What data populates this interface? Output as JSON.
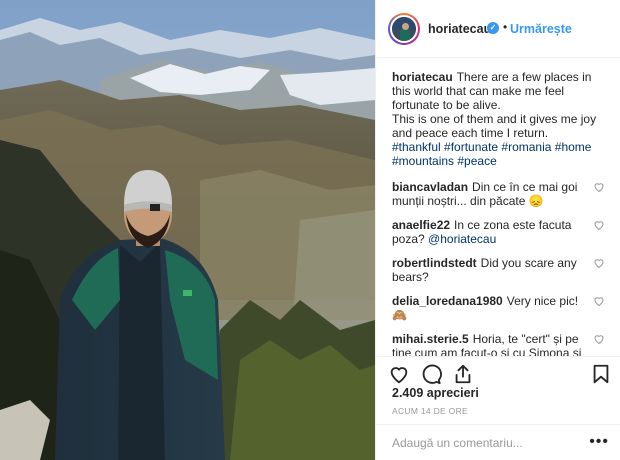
{
  "post": {
    "username": "horiatecau",
    "follow_label": "Urmărește",
    "dot": "•",
    "caption": {
      "username": "horiatecau",
      "lines": [
        "There are a few places in this world that I can make me feel fortunate to be alive.",
        "This is one of them and it gives me joy and peace each time I return."
      ],
      "text1": "There are a few places in this world that can make me feel fortunate to be alive.",
      "text2": "This is one of them and it gives me joy and peace each time I return.",
      "hashtags": "#thankful #fortunate #romania #home #mountains #peace"
    },
    "comments": [
      {
        "username": "biancavladan",
        "text": "Din ce în ce mai goi munții noștri... din păcate 😞"
      },
      {
        "username": "anaelfie22",
        "text": "In ce zona este facuta poza?",
        "mention": "@horiatecau"
      },
      {
        "username": "robertlindstedt",
        "text": "Did you scare any bears?"
      },
      {
        "username": "delia_loredana1980",
        "text": "Very nice pic! 🙈"
      },
      {
        "username": "mihai.sterie.5",
        "text": "Horia, te \"cert\" și pe tine cum am facut-o și cu Simona și cu Marius, nu ar fi mai frumos sa scrii textul intai in romana dupa care si in engleza?"
      }
    ],
    "likes": "2.409 aprecieri",
    "time": "ACUM 14 DE ORE",
    "comment_placeholder": "Adaugă un comentariu...",
    "more": "•••"
  },
  "icons": {
    "verified": "verified-badge-icon",
    "heart": "heart-icon",
    "comment": "comment-icon",
    "share": "share-icon",
    "bookmark": "bookmark-icon"
  },
  "colors": {
    "link": "#3897f0",
    "hashtag": "#003569",
    "text": "#262626",
    "muted": "#999999"
  }
}
